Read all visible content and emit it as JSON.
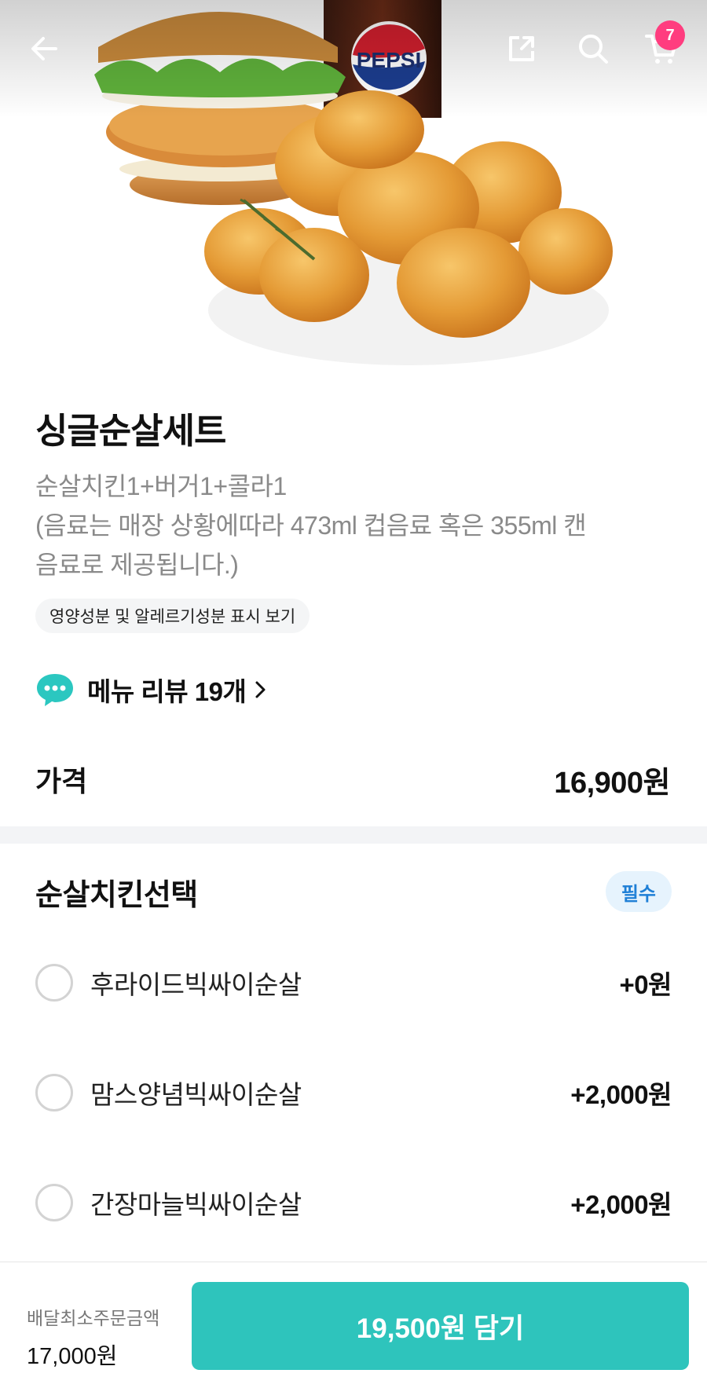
{
  "header": {
    "back_icon": "arrow-left-icon",
    "share_icon": "share-icon",
    "search_icon": "search-icon",
    "cart_icon": "cart-icon",
    "cart_count": "7",
    "hero_logo_text": "PEPSI"
  },
  "product": {
    "title": "싱글순살세트",
    "description_lines": [
      "순살치킨1+버거1+콜라1",
      "(음료는 매장 상황에따라 473ml 컵음료 혹은 355ml 캔",
      "음료로 제공됩니다.)"
    ],
    "nutrition_chip": "영양성분 및 알레르기성분 표시 보기",
    "review_label": "메뉴 리뷰 19개",
    "price_label": "가격",
    "price_value": "16,900원"
  },
  "options_group": {
    "title": "순살치킨선택",
    "badge": "필수",
    "items": [
      {
        "name": "후라이드빅싸이순살",
        "price": "+0원"
      },
      {
        "name": "맘스양념빅싸이순살",
        "price": "+2,000원"
      },
      {
        "name": "간장마늘빅싸이순살",
        "price": "+2,000원"
      }
    ]
  },
  "bottom_bar": {
    "min_order_label": "배달최소주문금액",
    "min_order_value": "17,000원",
    "cta_label": "19,500원 담기"
  },
  "colors": {
    "accent": "#2ec4bc",
    "badge_pink": "#ff3d7f",
    "required_badge_bg": "#e6f3fd",
    "required_badge_text": "#1e7fd6"
  }
}
